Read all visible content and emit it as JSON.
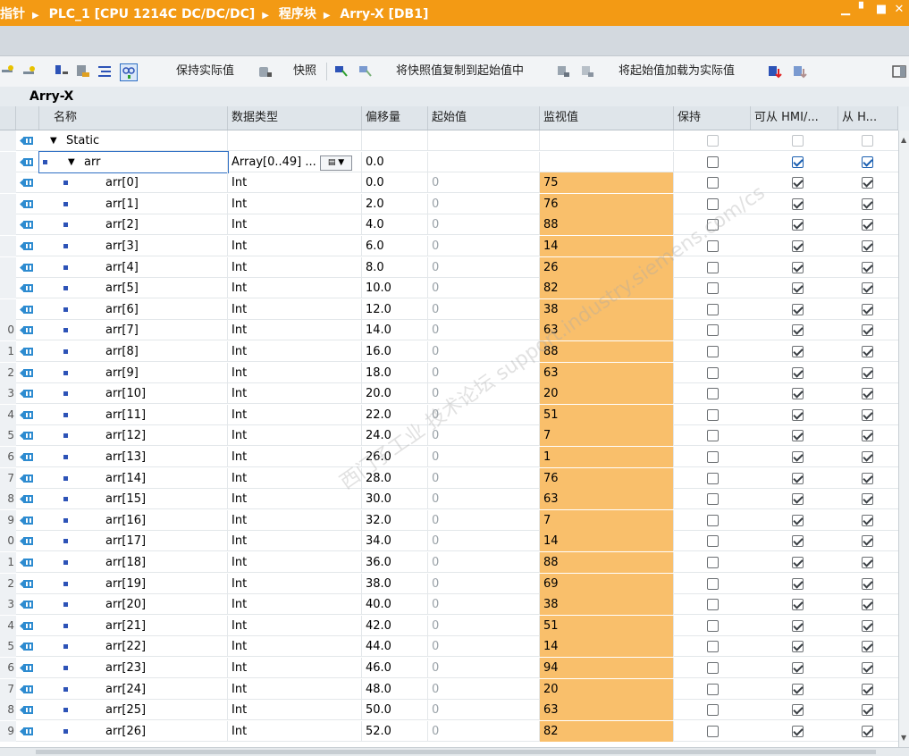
{
  "title": {
    "crumbs": [
      "指针",
      "PLC_1 [CPU 1214C DC/DC/DC]",
      "程序块",
      "Arry-X [DB1]"
    ]
  },
  "toolbar": {
    "keep_actual": "保持实际值",
    "snapshot": "快照",
    "copy_snapshot": "将快照值复制到起始值中",
    "load_start": "将起始值加载为实际值"
  },
  "block_name": "Arry-X",
  "headers": {
    "name": "名称",
    "datatype": "数据类型",
    "offset": "偏移量",
    "start": "起始值",
    "monitor": "监视值",
    "retain": "保持",
    "hmi_access": "可从 HMI/...",
    "hmi_visible": "从 H..."
  },
  "rows": [
    {
      "rn": "",
      "name": "Static",
      "type": "",
      "offset": "",
      "start": "",
      "monitor": "",
      "retain": false,
      "hmi1": false,
      "hmi2": false,
      "level": 0,
      "expand": true
    },
    {
      "rn": "",
      "name": "arr",
      "type": "Array[0..49] ...",
      "offset": "0.0",
      "start": "",
      "monitor": "",
      "retain": false,
      "hmi1": true,
      "hmi2": true,
      "level": 1,
      "expand": true
    },
    {
      "rn": "",
      "name": "arr[0]",
      "type": "Int",
      "offset": "0.0",
      "start": "0",
      "monitor": "75",
      "retain": false,
      "hmi1": true,
      "hmi2": true,
      "level": 2
    },
    {
      "rn": "",
      "name": "arr[1]",
      "type": "Int",
      "offset": "2.0",
      "start": "0",
      "monitor": "76",
      "retain": false,
      "hmi1": true,
      "hmi2": true,
      "level": 2
    },
    {
      "rn": "",
      "name": "arr[2]",
      "type": "Int",
      "offset": "4.0",
      "start": "0",
      "monitor": "88",
      "retain": false,
      "hmi1": true,
      "hmi2": true,
      "level": 2
    },
    {
      "rn": "",
      "name": "arr[3]",
      "type": "Int",
      "offset": "6.0",
      "start": "0",
      "monitor": "14",
      "retain": false,
      "hmi1": true,
      "hmi2": true,
      "level": 2
    },
    {
      "rn": "",
      "name": "arr[4]",
      "type": "Int",
      "offset": "8.0",
      "start": "0",
      "monitor": "26",
      "retain": false,
      "hmi1": true,
      "hmi2": true,
      "level": 2
    },
    {
      "rn": "",
      "name": "arr[5]",
      "type": "Int",
      "offset": "10.0",
      "start": "0",
      "monitor": "82",
      "retain": false,
      "hmi1": true,
      "hmi2": true,
      "level": 2
    },
    {
      "rn": "",
      "name": "arr[6]",
      "type": "Int",
      "offset": "12.0",
      "start": "0",
      "monitor": "38",
      "retain": false,
      "hmi1": true,
      "hmi2": true,
      "level": 2
    },
    {
      "rn": "0",
      "name": "arr[7]",
      "type": "Int",
      "offset": "14.0",
      "start": "0",
      "monitor": "63",
      "retain": false,
      "hmi1": true,
      "hmi2": true,
      "level": 2
    },
    {
      "rn": "1",
      "name": "arr[8]",
      "type": "Int",
      "offset": "16.0",
      "start": "0",
      "monitor": "88",
      "retain": false,
      "hmi1": true,
      "hmi2": true,
      "level": 2
    },
    {
      "rn": "2",
      "name": "arr[9]",
      "type": "Int",
      "offset": "18.0",
      "start": "0",
      "monitor": "63",
      "retain": false,
      "hmi1": true,
      "hmi2": true,
      "level": 2
    },
    {
      "rn": "3",
      "name": "arr[10]",
      "type": "Int",
      "offset": "20.0",
      "start": "0",
      "monitor": "20",
      "retain": false,
      "hmi1": true,
      "hmi2": true,
      "level": 2
    },
    {
      "rn": "4",
      "name": "arr[11]",
      "type": "Int",
      "offset": "22.0",
      "start": "0",
      "monitor": "51",
      "retain": false,
      "hmi1": true,
      "hmi2": true,
      "level": 2
    },
    {
      "rn": "5",
      "name": "arr[12]",
      "type": "Int",
      "offset": "24.0",
      "start": "0",
      "monitor": "7",
      "retain": false,
      "hmi1": true,
      "hmi2": true,
      "level": 2
    },
    {
      "rn": "6",
      "name": "arr[13]",
      "type": "Int",
      "offset": "26.0",
      "start": "0",
      "monitor": "1",
      "retain": false,
      "hmi1": true,
      "hmi2": true,
      "level": 2
    },
    {
      "rn": "7",
      "name": "arr[14]",
      "type": "Int",
      "offset": "28.0",
      "start": "0",
      "monitor": "76",
      "retain": false,
      "hmi1": true,
      "hmi2": true,
      "level": 2
    },
    {
      "rn": "8",
      "name": "arr[15]",
      "type": "Int",
      "offset": "30.0",
      "start": "0",
      "monitor": "63",
      "retain": false,
      "hmi1": true,
      "hmi2": true,
      "level": 2
    },
    {
      "rn": "9",
      "name": "arr[16]",
      "type": "Int",
      "offset": "32.0",
      "start": "0",
      "monitor": "7",
      "retain": false,
      "hmi1": true,
      "hmi2": true,
      "level": 2
    },
    {
      "rn": "0",
      "name": "arr[17]",
      "type": "Int",
      "offset": "34.0",
      "start": "0",
      "monitor": "14",
      "retain": false,
      "hmi1": true,
      "hmi2": true,
      "level": 2
    },
    {
      "rn": "1",
      "name": "arr[18]",
      "type": "Int",
      "offset": "36.0",
      "start": "0",
      "monitor": "88",
      "retain": false,
      "hmi1": true,
      "hmi2": true,
      "level": 2
    },
    {
      "rn": "2",
      "name": "arr[19]",
      "type": "Int",
      "offset": "38.0",
      "start": "0",
      "monitor": "69",
      "retain": false,
      "hmi1": true,
      "hmi2": true,
      "level": 2
    },
    {
      "rn": "3",
      "name": "arr[20]",
      "type": "Int",
      "offset": "40.0",
      "start": "0",
      "monitor": "38",
      "retain": false,
      "hmi1": true,
      "hmi2": true,
      "level": 2
    },
    {
      "rn": "4",
      "name": "arr[21]",
      "type": "Int",
      "offset": "42.0",
      "start": "0",
      "monitor": "51",
      "retain": false,
      "hmi1": true,
      "hmi2": true,
      "level": 2
    },
    {
      "rn": "5",
      "name": "arr[22]",
      "type": "Int",
      "offset": "44.0",
      "start": "0",
      "monitor": "14",
      "retain": false,
      "hmi1": true,
      "hmi2": true,
      "level": 2
    },
    {
      "rn": "6",
      "name": "arr[23]",
      "type": "Int",
      "offset": "46.0",
      "start": "0",
      "monitor": "94",
      "retain": false,
      "hmi1": true,
      "hmi2": true,
      "level": 2
    },
    {
      "rn": "7",
      "name": "arr[24]",
      "type": "Int",
      "offset": "48.0",
      "start": "0",
      "monitor": "20",
      "retain": false,
      "hmi1": true,
      "hmi2": true,
      "level": 2
    },
    {
      "rn": "8",
      "name": "arr[25]",
      "type": "Int",
      "offset": "50.0",
      "start": "0",
      "monitor": "63",
      "retain": false,
      "hmi1": true,
      "hmi2": true,
      "level": 2
    },
    {
      "rn": "9",
      "name": "arr[26]",
      "type": "Int",
      "offset": "52.0",
      "start": "0",
      "monitor": "82",
      "retain": false,
      "hmi1": true,
      "hmi2": true,
      "level": 2
    }
  ],
  "watermark": "西门子工业 技术论坛 support.industry.siemens.com/cs",
  "colors": {
    "titlebar": "#f39a14",
    "monitor_cell": "#f9bf6b",
    "tag_icon": "#2d53b7"
  },
  "icons": {
    "tag": "db-tag-icon",
    "member": "member-square-icon",
    "expand": "triangle-down-icon",
    "datatype_picker": "datatype-picker-icon"
  }
}
